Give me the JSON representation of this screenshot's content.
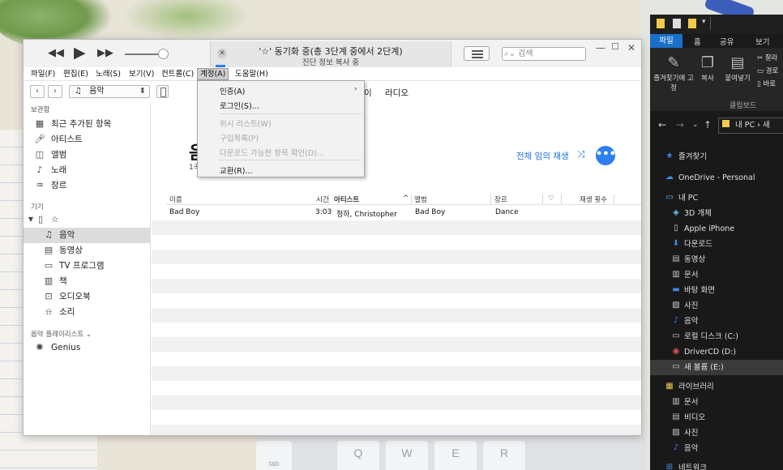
{
  "itunes": {
    "lcd": {
      "title": "'☆' 동기화 중(총 3단계 중에서 2단계)",
      "subtitle": "진단 정보 복사 중"
    },
    "search_placeholder": "검색",
    "window_controls": {
      "minimize": "—",
      "maximize": "☐",
      "close": "✕"
    },
    "menu": [
      "파일(F)",
      "편집(E)",
      "노래(S)",
      "보기(V)",
      "컨트롤(C)",
      "계정(A)",
      "도움말(H)"
    ],
    "media_select": "음악",
    "nav_tabs": [
      "이",
      "라디오"
    ],
    "account_menu": {
      "items": [
        {
          "label": "인증(A)",
          "disabled": false,
          "submenu": true
        },
        {
          "label": "로그인(S)...",
          "disabled": false
        },
        {
          "label": "위시 리스트(W)",
          "disabled": true
        },
        {
          "label": "구입목록(P)",
          "disabled": true
        },
        {
          "label": "다운로드 가능한 항목 확인(D)...",
          "disabled": true
        },
        {
          "label": "교환(R)...",
          "disabled": false
        }
      ]
    },
    "sidebar": {
      "library_header": "보관함",
      "library": [
        {
          "icon": "grid-icon",
          "label": "최근 추가된 항목"
        },
        {
          "icon": "microphone-icon",
          "label": "아티스트"
        },
        {
          "icon": "album-icon",
          "label": "앨범"
        },
        {
          "icon": "note-icon",
          "label": "노래"
        },
        {
          "icon": "guitar-icon",
          "label": "장르"
        }
      ],
      "devices_header": "기기",
      "device_name": "☆",
      "device_items": [
        {
          "icon": "note-icon",
          "label": "음악",
          "selected": true
        },
        {
          "icon": "film-icon",
          "label": "동영상"
        },
        {
          "icon": "tv-icon",
          "label": "TV 프로그램"
        },
        {
          "icon": "book-icon",
          "label": "책"
        },
        {
          "icon": "audiobook-icon",
          "label": "오디오북"
        },
        {
          "icon": "bell-icon",
          "label": "소리"
        }
      ],
      "playlists_header": "음악 플레이리스트 ⌄",
      "playlists": [
        {
          "icon": "genius-icon",
          "label": "Genius"
        }
      ]
    },
    "content": {
      "title": "음",
      "count": "1곡",
      "shuffle_label": "전체 임의 재생",
      "more_label": "•••",
      "columns": [
        "이름",
        "시간",
        "아티스트",
        "앨범",
        "장르",
        "♡",
        "재생 횟수"
      ],
      "sort_indicator": "^",
      "rows": [
        {
          "name": "Bad Boy",
          "time": "3:03",
          "artist": "청하, Christopher",
          "album": "Bad Boy",
          "genre": "Dance"
        }
      ]
    }
  },
  "explorer": {
    "ribbon_tabs": [
      "파일",
      "홈",
      "공유",
      "보기"
    ],
    "tools": [
      {
        "icon": "pin-icon",
        "label": "즐겨찾기에 고정"
      },
      {
        "icon": "copy-icon",
        "label": "복사"
      },
      {
        "icon": "paste-icon",
        "label": "붙여넣기"
      }
    ],
    "side_tools": [
      "잘라",
      "경로",
      "바로"
    ],
    "clipboard_label": "클립보드",
    "path": "내 PC › 새",
    "nav": [
      {
        "icon": "star-icon",
        "label": "즐겨찾기",
        "indent": 1
      },
      {
        "icon": "cloud-icon",
        "label": "OneDrive - Personal",
        "indent": 1
      },
      {
        "icon": "pc-icon",
        "label": "내 PC",
        "indent": 1
      },
      {
        "icon": "cube-icon",
        "label": "3D 개체",
        "indent": 2
      },
      {
        "icon": "phone-icon",
        "label": "Apple iPhone",
        "indent": 2
      },
      {
        "icon": "download-icon",
        "label": "다운로드",
        "indent": 2
      },
      {
        "icon": "video-icon",
        "label": "동영상",
        "indent": 2
      },
      {
        "icon": "document-icon",
        "label": "문서",
        "indent": 2
      },
      {
        "icon": "desktop-icon",
        "label": "바탕 화면",
        "indent": 2
      },
      {
        "icon": "picture-icon",
        "label": "사진",
        "indent": 2
      },
      {
        "icon": "music-icon",
        "label": "음악",
        "indent": 2
      },
      {
        "icon": "drive-icon",
        "label": "로컬 디스크 (C:)",
        "indent": 2
      },
      {
        "icon": "cd-icon",
        "label": "DriverCD (D:)",
        "indent": 2
      },
      {
        "icon": "drive-icon",
        "label": "새 볼륨 (E:)",
        "indent": 2,
        "selected": true
      },
      {
        "icon": "library-icon",
        "label": "라이브러리",
        "indent": 1
      },
      {
        "icon": "document-icon",
        "label": "문서",
        "indent": 2
      },
      {
        "icon": "video-icon",
        "label": "비디오",
        "indent": 2
      },
      {
        "icon": "picture-icon",
        "label": "사진",
        "indent": 2
      },
      {
        "icon": "music-icon",
        "label": "음악",
        "indent": 2
      },
      {
        "icon": "network-icon",
        "label": "네트워크",
        "indent": 1
      }
    ]
  },
  "background": {
    "keys": [
      "Q",
      "W",
      "E",
      "R"
    ],
    "tab_key": "tab"
  }
}
